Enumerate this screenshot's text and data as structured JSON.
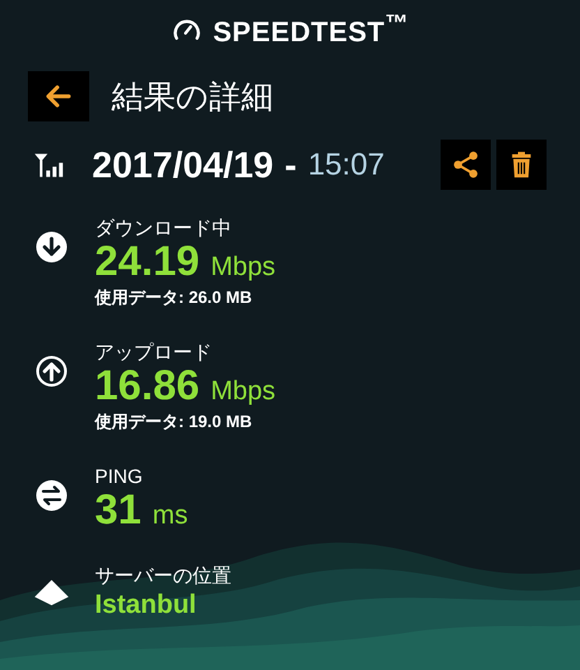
{
  "app": {
    "logo": "SPEEDTEST$^{™}$"
  },
  "header": {
    "title": "結果の詳細"
  },
  "result": {
    "date": "2017/04/19",
    "separator": "-",
    "time": "15:07"
  },
  "metrics": [
    {
      "kind": "download",
      "label": "ダウンロード中",
      "value": "24.19",
      "unit": "Mbps",
      "data": "使用データ: 26.0 MB"
    },
    {
      "kind": "upload",
      "label": "アップロード",
      "value": "16.86",
      "unit": "Mbps",
      "data": "使用データ: 19.0 MB"
    },
    {
      "kind": "ping",
      "label": "PING",
      "value": "31",
      "unit": "ms"
    },
    {
      "kind": "server",
      "label": "サーバーの位置",
      "value": "Istanbul"
    }
  ]
}
